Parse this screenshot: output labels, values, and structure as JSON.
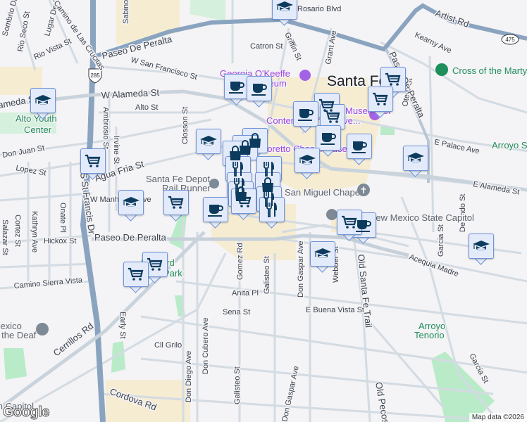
{
  "map": {
    "city_label": "Santa Fe",
    "streets": {
      "paseo_de_peralta_n": "Paseo De Peralta",
      "paseo_de_peralta_s": "Paseo De Peralta",
      "paseo_de_peralta_e": "Paseo De Peralta",
      "w_alameda": "W Alameda St",
      "alameda_w": "ameda St",
      "e_alameda": "E Alameda St",
      "w_san_francisco": "W San Francisco St",
      "alto": "Alto St",
      "closson": "Closson St",
      "ambrosio": "Ambrosio St",
      "irvine": "Irvine St",
      "don_juan": "Don Juan St",
      "lopez": "Lopez St",
      "agua_fria": "Agua Fria St",
      "st_francis": "S St Francis Dr",
      "w_manhattan": "W Manhattan Ave",
      "onate": "Onate Pl",
      "kathryn": "Kathryn Ave",
      "cortez": "Cortez St",
      "salazar": "Salazar St",
      "hickox": "Hickox St",
      "camino_sierra_vista": "Camino Sierra Vista",
      "early": "Early St",
      "cerrillos": "Cerrillos Rd",
      "cordova": "Cordova Rd",
      "cll_grillo": "Cll Grilo",
      "don_diego": "Don Diego Ave",
      "don_cubero": "Don Cubero Ave",
      "galisteo_n": "Galisteo St",
      "galisteo_s": "Galisteo St",
      "gomez": "Gomez Rd",
      "anita": "Anita Pl",
      "sena": "Sena St",
      "e_buena_vista": "E Buena Vista St",
      "don_gaspar_n": "Don Gaspar Ave",
      "don_gaspar_s": "Don Gaspar Ave",
      "webber": "Webber St",
      "old_santa_fe_trail": "Old Santa Fe Trail",
      "old_pecos": "Old Pecos",
      "acequia_madre": "Acequia Madre",
      "garcia_n": "Garcia St",
      "garcia_s": "Garcia St",
      "delgado": "Delgado St",
      "e_palace": "E Palace Ave",
      "otero": "Otero St",
      "kearny": "Kearny Ave",
      "artist": "Artist Rd",
      "rosario": "Rosario Blvd",
      "griffin": "Griffin St",
      "grant": "Grant Ave",
      "catron": "Catron St",
      "sabino": "Sabino",
      "sombrio": "Sombrio Dr",
      "rio_seco": "Rio Seco St",
      "lugar_de_oro": "Lugar De Oro",
      "las_crucitas": "Camino de Las Crucitas",
      "rio_vista": "Rio Vista St"
    },
    "shields": {
      "us285": "285",
      "nm475": "475"
    },
    "pois": {
      "okeeffe_line1": "Georgia O'Keeffe",
      "okeeffe_line2": "Museum",
      "contemporary": "Contemporary Native...",
      "museum_of": "Museum of",
      "loretto": "Loretto Chapel Museum",
      "san_miguel": "San Miguel Chapel",
      "capitol": "New Mexico State Capitol",
      "depot_line1": "Santa Fe Depot",
      "depot_line2": "Rail Runner",
      "alto_line1": "Alto Youth",
      "alto_line2": "Center",
      "cross": "Cross of the Martyrs",
      "arroyo_s": "Arroyo Sainz",
      "arroyo_t1": "Arroyo",
      "arroyo_t2": "Tenorio",
      "deaf_line1": "New Mexico",
      "deaf_line2": "School for the Deaf",
      "railyard_park_1": "Railyard",
      "railyard_park_2": "Park",
      "capitol_station": "South Capitol"
    },
    "colors": {
      "highway": "#8aa4c0",
      "marker_fill": "#e3ebfb",
      "marker_border": "#6f93d8",
      "icon": "#0d3b5e",
      "park": "#b9ebc8",
      "commercial": "#f6ecd2"
    }
  },
  "markers": [
    "school",
    "coffee",
    "coffee",
    "grocery",
    "grocery",
    "grocery",
    "coffee",
    "grocery",
    "coffee",
    "coffee",
    "school",
    "school",
    "school",
    "grocery",
    "school",
    "shopping",
    "shopping",
    "shopping",
    "restaurant",
    "restaurant",
    "restaurant",
    "shopping",
    "shopping",
    "restaurant",
    "grocery",
    "restaurant",
    "coffee",
    "grocery",
    "school",
    "coffee",
    "grocery",
    "school",
    "school",
    "grocery",
    "grocery"
  ],
  "footer": {
    "attribution": "Map data ©2026",
    "logo": "Google"
  }
}
